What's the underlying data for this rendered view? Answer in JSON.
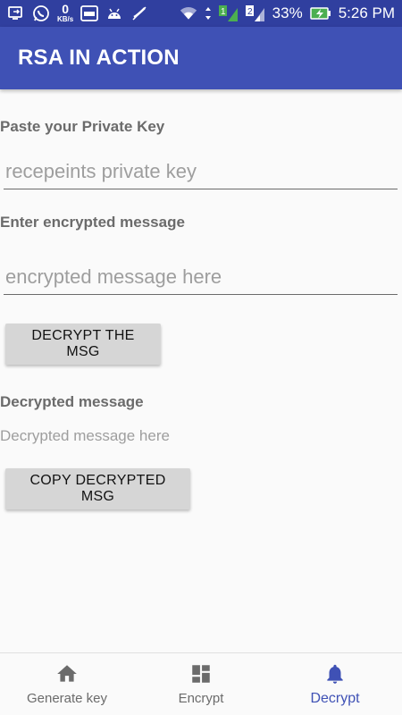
{
  "status_bar": {
    "speed_value": "0",
    "speed_unit": "KB/s",
    "sim1": "1",
    "sim2": "2",
    "battery": "33%",
    "time": "5:26 PM"
  },
  "app_bar": {
    "title": "RSA IN ACTION"
  },
  "form": {
    "private_key_label": "Paste your Private Key",
    "private_key_placeholder": "recepeints private key",
    "private_key_value": "",
    "encrypted_label": "Enter encrypted message",
    "encrypted_placeholder": "encrypted message here",
    "encrypted_value": "",
    "decrypt_button": "DECRYPT THE MSG",
    "decrypted_label": "Decrypted message",
    "decrypted_text": "Decrypted message here",
    "copy_button": "COPY DECRYPTED MSG"
  },
  "bottom_nav": {
    "items": [
      {
        "label": "Generate key",
        "icon": "home-icon",
        "active": false
      },
      {
        "label": "Encrypt",
        "icon": "dashboard-icon",
        "active": false
      },
      {
        "label": "Decrypt",
        "icon": "bell-icon",
        "active": true
      }
    ]
  },
  "colors": {
    "status_bar": "#303f9f",
    "primary": "#3f51b5",
    "button_bg": "#d6d6d6",
    "nav_inactive": "#6b6b6b"
  }
}
